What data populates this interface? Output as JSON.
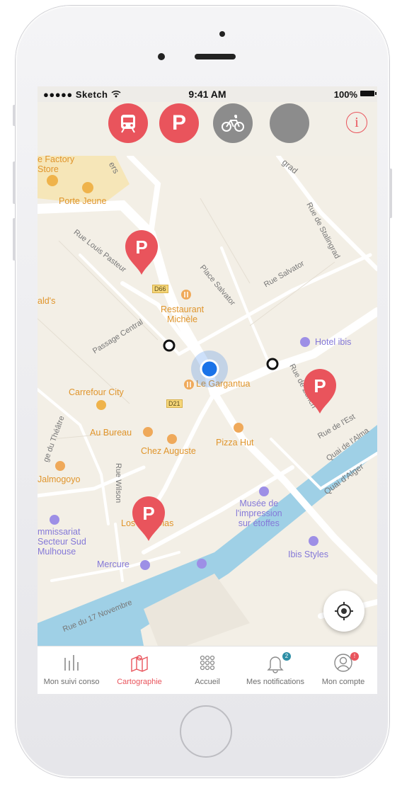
{
  "status_bar": {
    "carrier": "●●●●● Sketch",
    "time": "9:41 AM",
    "battery": "100%"
  },
  "top_bar": {
    "buttons": [
      {
        "name": "transport-filter",
        "icon": "tram-icon",
        "color": "#e9545c"
      },
      {
        "name": "parking-filter",
        "icon": "parking-p-icon",
        "label": "P",
        "color": "#e9545c"
      },
      {
        "name": "bike-filter",
        "icon": "bicycle-icon",
        "color": "#8c8c8c"
      },
      {
        "name": "blank-filter",
        "icon": "none",
        "color": "#8c8c8c"
      }
    ],
    "info_label": "i"
  },
  "map": {
    "places": [
      {
        "name": "e Factory Store",
        "line1": "e Factory",
        "line2": "Store",
        "color": "#e0952c"
      },
      {
        "name": "Porte Jeune",
        "color": "#e0952c"
      },
      {
        "name": "Restaurant Michèle",
        "line1": "Restaurant",
        "line2": "Michèle",
        "color": "#e0952c"
      },
      {
        "name": "Le Gargantua",
        "color": "#e0952c"
      },
      {
        "name": "Carrefour City",
        "color": "#e0952c"
      },
      {
        "name": "Au Bureau",
        "color": "#e0952c"
      },
      {
        "name": "Chez Auguste",
        "color": "#e0952c"
      },
      {
        "name": "Pizza Hut",
        "color": "#e0952c"
      },
      {
        "name": "Jalmogoyo",
        "color": "#e0952c"
      },
      {
        "name": "Los Dos Dias",
        "color": "#e0952c"
      },
      {
        "name": "ald's",
        "color": "#e0952c"
      },
      {
        "name": "Hotel ibis",
        "color": "#8478d8"
      },
      {
        "name": "Mercure",
        "color": "#8478d8"
      },
      {
        "name": "Ibis Styles",
        "color": "#8478d8"
      },
      {
        "name": "Musée de l'impression sur étoffes",
        "line1": "Musée de",
        "line2": "l'impression",
        "line3": "sur étoffes",
        "color": "#8478d8"
      },
      {
        "name": "mmissariat Secteur Sud Mulhouse",
        "line1": "mmissariat",
        "line2": "Secteur Sud",
        "line3": "Mulhouse",
        "color": "#8478d8"
      }
    ],
    "roads": [
      "Rue de Stalingrad",
      "Rue Salvator",
      "Place Salvator",
      "Rue Louis Pasteur",
      "Passage Central",
      "Rue de Zurich",
      "Rue de l'Est",
      "Quai de l'Alma",
      "Quai d'Alger",
      "ge du Théâtre",
      "Rue Wilson",
      "Rue du 17 Novembre",
      "ers",
      "grad"
    ],
    "road_shields": [
      "D66",
      "D21"
    ],
    "parking_pin_label": "P"
  },
  "tab_bar": {
    "tabs": [
      {
        "label": "Mon suivi conso",
        "icon": "bar-chart-icon",
        "active": false
      },
      {
        "label": "Cartographie",
        "icon": "map-icon",
        "active": true
      },
      {
        "label": "Accueil",
        "icon": "grid-icon",
        "active": false
      },
      {
        "label": "Mes notifications",
        "icon": "bell-icon",
        "active": false,
        "badge": "2",
        "badge_color": "#2e8fa6"
      },
      {
        "label": "Mon compte",
        "icon": "user-icon",
        "active": false,
        "badge": "!",
        "badge_color": "#e9545c"
      }
    ]
  },
  "colors": {
    "accent": "#e9545c",
    "user_location": "#1a73e8",
    "water": "#9fd0e6"
  }
}
